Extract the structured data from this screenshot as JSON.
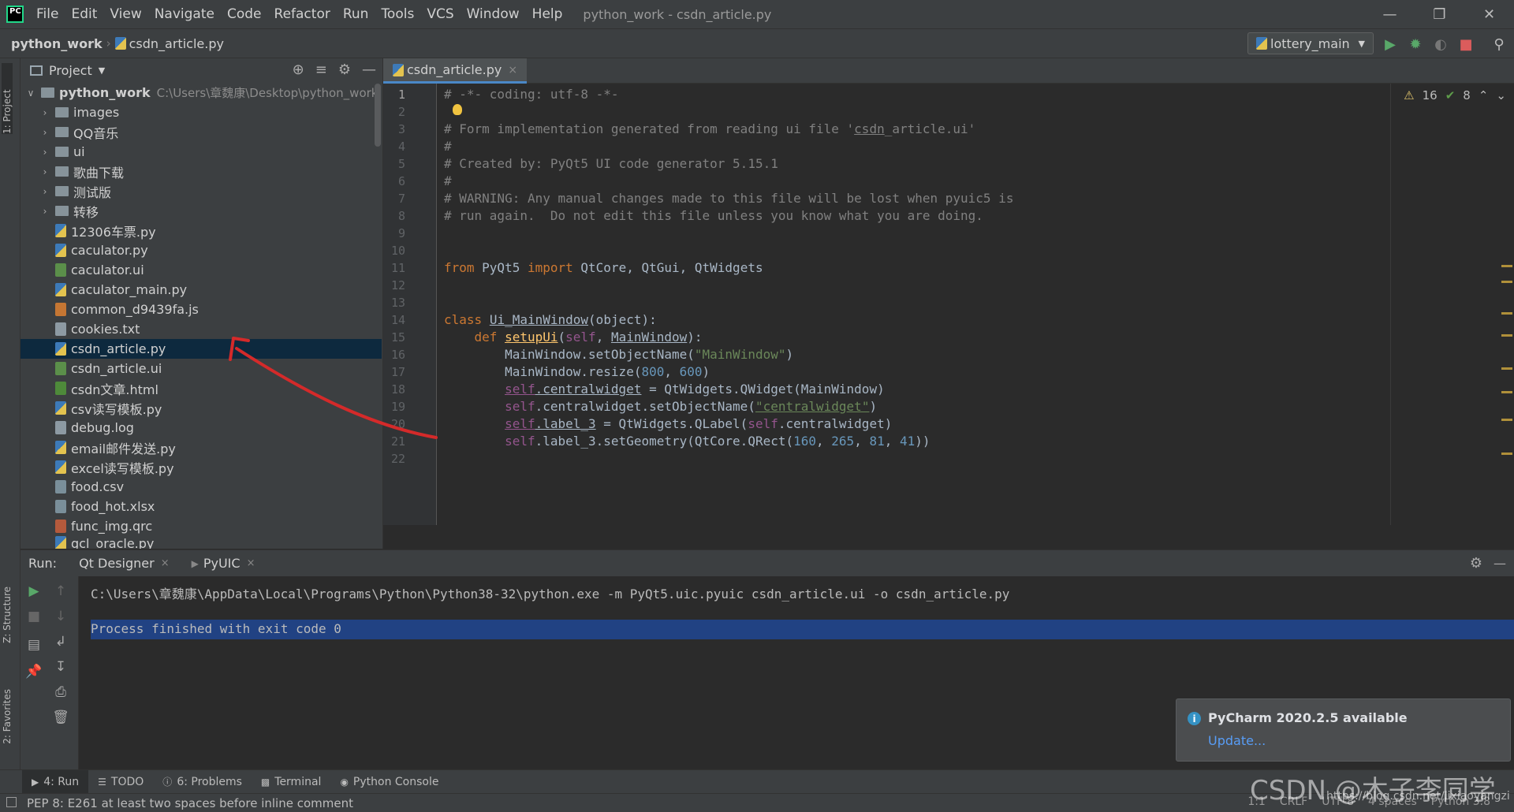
{
  "menubar": {
    "items": [
      "File",
      "Edit",
      "View",
      "Navigate",
      "Code",
      "Refactor",
      "Run",
      "Tools",
      "VCS",
      "Window",
      "Help"
    ],
    "title": "python_work - csdn_article.py"
  },
  "navbar": {
    "project": "python_work",
    "file": "csdn_article.py",
    "run_config": "lottery_main"
  },
  "left_strip": {
    "project_tab": "1: Project",
    "structure_tab": "Z: Structure",
    "favorites_tab": "2: Favorites"
  },
  "project_panel": {
    "header": "Project",
    "root_name": "python_work",
    "root_path": "C:\\Users\\章魏康\\Desktop\\python_work",
    "folders": [
      "images",
      "QQ音乐",
      "ui",
      "歌曲下载",
      "测试版",
      "转移"
    ],
    "files": [
      {
        "name": "12306车票.py",
        "type": "py"
      },
      {
        "name": "caculator.py",
        "type": "py"
      },
      {
        "name": "caculator.ui",
        "type": "ui"
      },
      {
        "name": "caculator_main.py",
        "type": "py"
      },
      {
        "name": "common_d9439fa.js",
        "type": "js"
      },
      {
        "name": "cookies.txt",
        "type": "txt"
      },
      {
        "name": "csdn_article.py",
        "type": "py",
        "selected": true
      },
      {
        "name": "csdn_article.ui",
        "type": "ui"
      },
      {
        "name": "csdn文章.html",
        "type": "html"
      },
      {
        "name": "csv读写模板.py",
        "type": "py"
      },
      {
        "name": "debug.log",
        "type": "txt"
      },
      {
        "name": "email邮件发送.py",
        "type": "py"
      },
      {
        "name": "excel读写模板.py",
        "type": "py"
      },
      {
        "name": "food.csv",
        "type": "csv"
      },
      {
        "name": "food_hot.xlsx",
        "type": "csv"
      },
      {
        "name": "func_img.qrc",
        "type": "qrc"
      },
      {
        "name": "gcl_oracle.py",
        "type": "py"
      }
    ]
  },
  "editor": {
    "tab": "csdn_article.py",
    "warnings": "16",
    "weak_warnings": "8",
    "line_numbers": [
      "1",
      "2",
      "3",
      "4",
      "5",
      "6",
      "7",
      "8",
      "9",
      "10",
      "11",
      "12",
      "13",
      "14",
      "15",
      "16",
      "17",
      "18",
      "19",
      "20",
      "21",
      "22"
    ],
    "code": {
      "l1": "# -*- coding: utf-8 -*-",
      "l3a": "# Form implementation generated from reading ui file '",
      "l3b": "csdn",
      "l3c": "_article.ui'",
      "l4": "#",
      "l5": "# Created by: PyQt5 UI code generator 5.15.1",
      "l6": "#",
      "l7": "# WARNING: Any manual changes made to this file will be lost when pyuic5 is",
      "l8": "# run again.  Do not edit this file unless you know what you are doing.",
      "l11_from": "from",
      "l11_mod": " PyQt5 ",
      "l11_import": "import",
      "l11_rest": " QtCore, QtGui, QtWidgets",
      "l14_class": "class",
      "l14_name": "Ui_MainWindow",
      "l14_rest": "(object):",
      "l15_def": "def",
      "l15_name": "setupUi",
      "l15_self": "self",
      "l15_arg": "MainWindow",
      "l16a": "MainWindow.setObjectName(",
      "l16s": "\"MainWindow\"",
      "l16b": ")",
      "l17a": "MainWindow.resize(",
      "l17n1": "800",
      "l17n2": "600",
      "l18_self": "self",
      "l18_attr": ".centralwidget",
      "l18_rest": " = QtWidgets.QWidget(MainWindow)",
      "l19_self": "self",
      "l19a": ".centralwidget.setObjectName(",
      "l19s": "\"centralwidget\"",
      "l20_self": "self",
      "l20_attr": ".label_3",
      "l20a": " = QtWidgets.QLabel(",
      "l20_self2": "self",
      "l20b": ".centralwidget)",
      "l21_self": "self",
      "l21a": ".label_3.setGeometry(QtCore.QRect(",
      "l21n1": "160",
      "l21n2": "265",
      "l21n3": "81",
      "l21n4": "41",
      "l21b": "))"
    }
  },
  "run_panel": {
    "title": "Run:",
    "tabs": [
      "Qt Designer",
      "PyUIC"
    ],
    "command": "C:\\Users\\章魏康\\AppData\\Local\\Programs\\Python\\Python38-32\\python.exe -m PyQt5.uic.pyuic csdn_article.ui -o csdn_article.py",
    "result": "Process finished with exit code 0"
  },
  "notification": {
    "title": "PyCharm 2020.2.5 available",
    "link": "Update..."
  },
  "bottom_tabs": [
    {
      "label": "4: Run",
      "icon": "run-icon"
    },
    {
      "label": "TODO",
      "icon": "todo-icon"
    },
    {
      "label": "6: Problems",
      "icon": "problems-icon"
    },
    {
      "label": "Terminal",
      "icon": "terminal-icon"
    },
    {
      "label": "Python Console",
      "icon": "python-console-icon"
    }
  ],
  "status": {
    "message": "PEP 8: E261 at least two spaces before inline comment",
    "position": "1:1",
    "line_sep": "CRLF",
    "encoding": "UTF-8",
    "indent": "4 spaces",
    "interpreter": "Python 3.8"
  },
  "watermark": {
    "text": "CSDN @木子李同学",
    "url": "https://blog.csdn.net/lixiaoyangzi"
  },
  "colors": {
    "accent": "#4a88c7",
    "selection": "#0d293e",
    "console_highlight": "#214283",
    "annotation_arrow": "#d42a2a"
  }
}
